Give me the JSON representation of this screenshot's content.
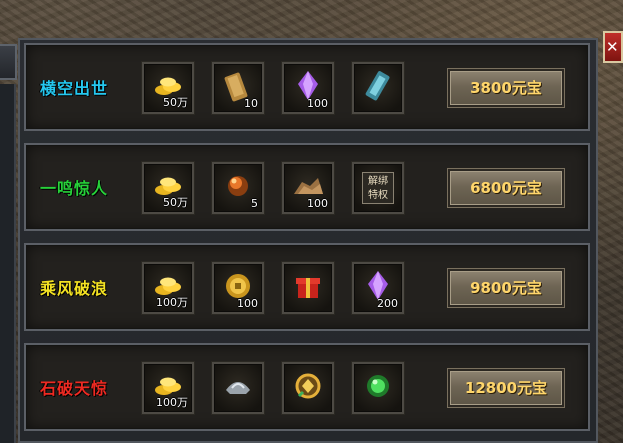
{
  "colors": {
    "accent_price": "#ffd66b",
    "close_red": "#b8241d"
  },
  "close_icon": "close-icon",
  "packages": [
    {
      "title": "横空出世",
      "title_color": "#25c8f0",
      "price": "3800元宝",
      "items": [
        {
          "icon": "gold-ingots-icon",
          "qty": "50万"
        },
        {
          "icon": "scroll-bundle-icon",
          "qty": "10"
        },
        {
          "icon": "purple-crystal-icon",
          "qty": "100"
        },
        {
          "icon": "blue-talisman-icon",
          "qty": ""
        }
      ]
    },
    {
      "title": "一鸣惊人",
      "title_color": "#27d23a",
      "price": "6800元宝",
      "items": [
        {
          "icon": "gold-ingots-icon",
          "qty": "50万"
        },
        {
          "icon": "fire-orb-icon",
          "qty": "5"
        },
        {
          "icon": "ore-pile-icon",
          "qty": "100"
        },
        {
          "icon": "privilege-badge-icon",
          "qty": "",
          "badge_text": "解绑特权"
        }
      ]
    },
    {
      "title": "乘风破浪",
      "title_color": "#f4e223",
      "price": "9800元宝",
      "items": [
        {
          "icon": "gold-ingots-icon",
          "qty": "100万"
        },
        {
          "icon": "gold-coin-icon",
          "qty": "100"
        },
        {
          "icon": "red-gift-box-icon",
          "qty": ""
        },
        {
          "icon": "purple-crystal-icon",
          "qty": "200"
        }
      ]
    },
    {
      "title": "石破天惊",
      "title_color": "#ee2a22",
      "price": "12800元宝",
      "items": [
        {
          "icon": "gold-ingots-icon",
          "qty": "100万"
        },
        {
          "icon": "silver-helmet-icon",
          "qty": ""
        },
        {
          "icon": "gold-medallion-icon",
          "qty": ""
        },
        {
          "icon": "green-jade-orb-icon",
          "qty": ""
        }
      ]
    }
  ]
}
